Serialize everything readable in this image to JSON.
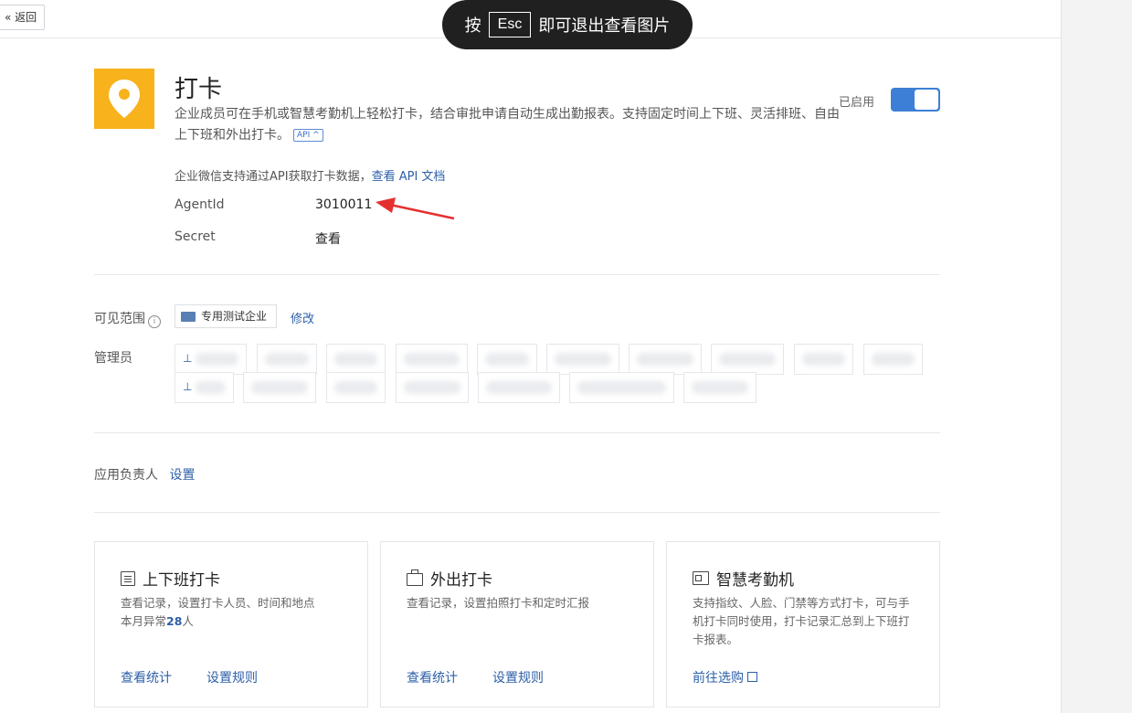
{
  "topbar": {
    "back_label": "返回"
  },
  "toast": {
    "prefix": "按",
    "key": "Esc",
    "suffix": "即可退出查看图片"
  },
  "app": {
    "title": "打卡",
    "description": "企业成员可在手机或智慧考勤机上轻松打卡，结合审批申请自动生成出勤报表。支持固定时间上下班、灵活排班、自由上下班和外出打卡。",
    "api_tag": "API ^",
    "status_label": "已启用",
    "enabled": true,
    "accent_color": "#f7b21c"
  },
  "api_note": {
    "text": "企业微信支持通过API获取打卡数据，",
    "link": "查看 API 文档"
  },
  "credentials": {
    "agentid_label": "AgentId",
    "agentid_value": "3010011",
    "secret_label": "Secret",
    "secret_action": "查看"
  },
  "visibility": {
    "label": "可见范围",
    "scope": "专用测试企业",
    "edit": "修改"
  },
  "admins": {
    "label": "管理员"
  },
  "owner": {
    "label": "应用负责人",
    "action": "设置"
  },
  "cards": [
    {
      "icon": "list-icon",
      "title": "上下班打卡",
      "desc_line1": "查看记录，设置打卡人员、时间和地点",
      "desc_prefix": "本月异常",
      "desc_count": "28",
      "desc_suffix": "人",
      "link1": "查看统计",
      "link2": "设置规则"
    },
    {
      "icon": "briefcase-icon",
      "title": "外出打卡",
      "desc": "查看记录，设置拍照打卡和定时汇报",
      "link1": "查看统计",
      "link2": "设置规则"
    },
    {
      "icon": "attendance-machine-icon",
      "title": "智慧考勤机",
      "desc": "支持指纹、人脸、门禁等方式打卡，可与手机打卡同时使用，打卡记录汇总到上下班打卡报表。",
      "link1": "前往选购"
    }
  ]
}
